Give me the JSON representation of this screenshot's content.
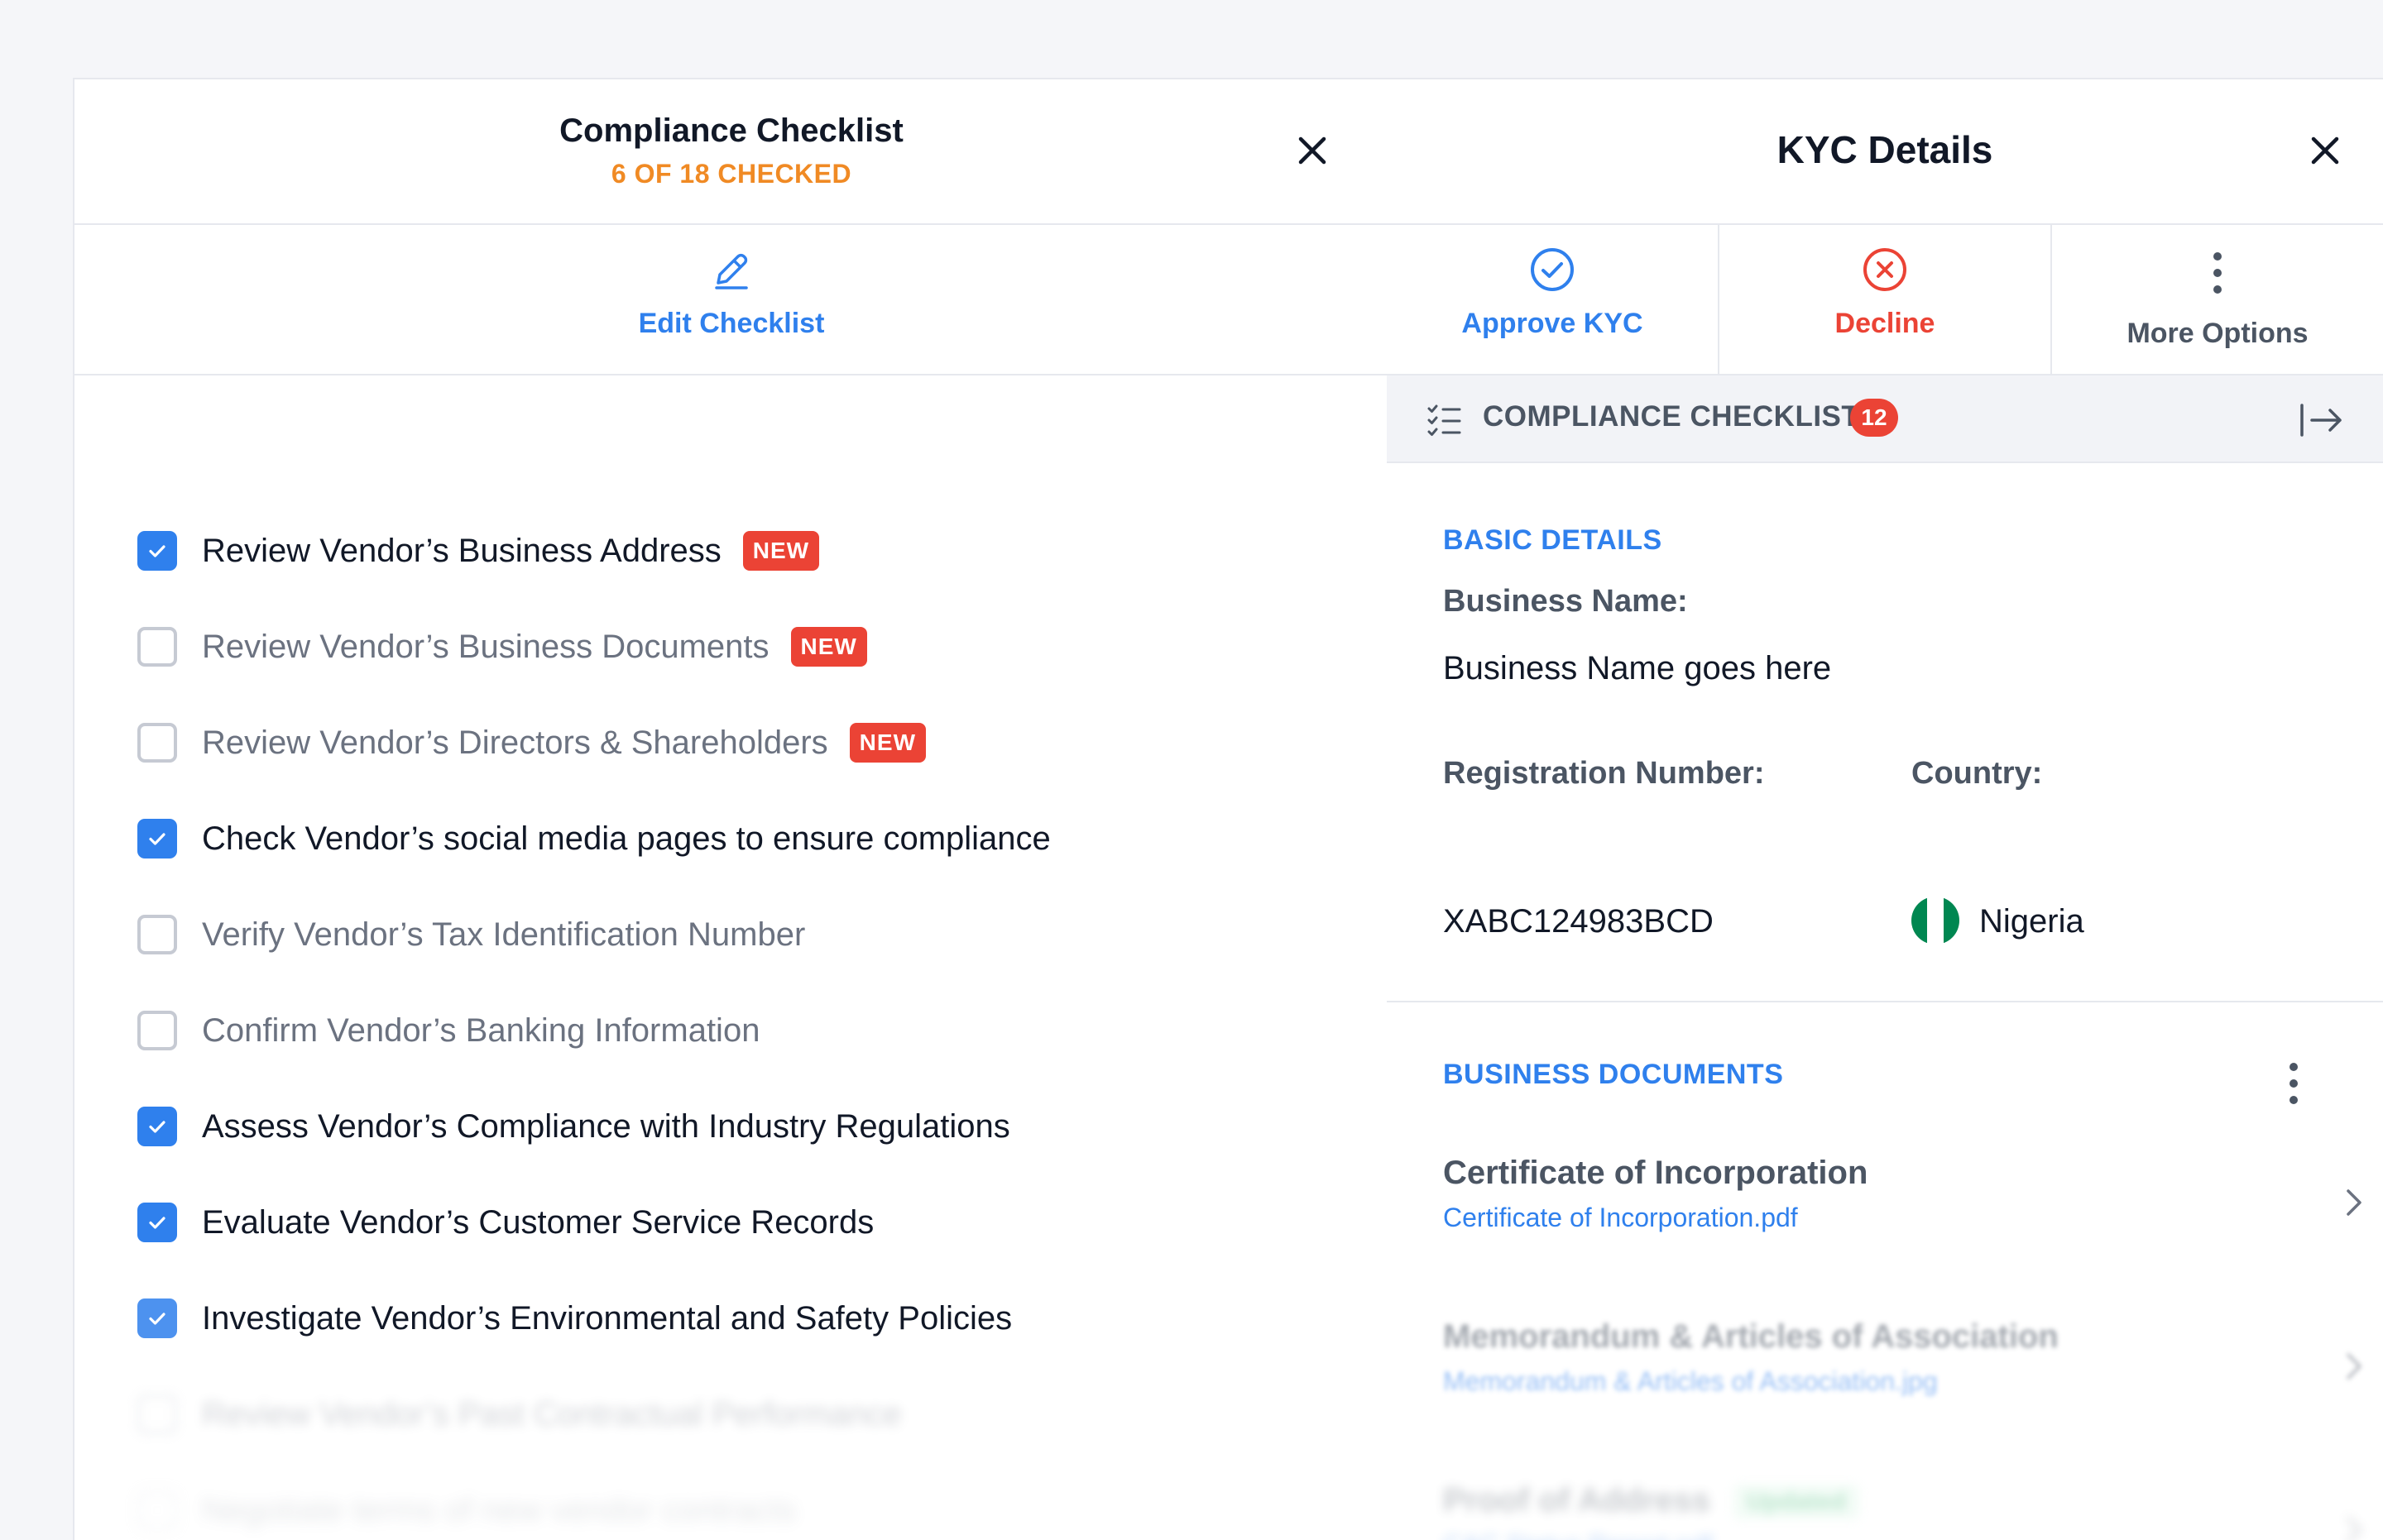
{
  "checklist_panel": {
    "title": "Compliance Checklist",
    "subtitle": "6 OF 18 CHECKED",
    "edit_label": "Edit Checklist",
    "new_badge": "NEW",
    "items": [
      {
        "label": "Review Vendor’s Business Address",
        "checked": true,
        "is_new": true
      },
      {
        "label": "Review Vendor’s Business Documents",
        "checked": false,
        "is_new": true
      },
      {
        "label": "Review Vendor’s Directors & Shareholders",
        "checked": false,
        "is_new": true
      },
      {
        "label": "Check Vendor’s social media pages to ensure compliance",
        "checked": true,
        "is_new": false
      },
      {
        "label": "Verify Vendor’s Tax Identification Number",
        "checked": false,
        "is_new": false
      },
      {
        "label": "Confirm Vendor’s Banking Information",
        "checked": false,
        "is_new": false
      },
      {
        "label": "Assess Vendor’s Compliance with Industry Regulations",
        "checked": true,
        "is_new": false
      },
      {
        "label": "Evaluate Vendor’s Customer Service Records",
        "checked": true,
        "is_new": false
      },
      {
        "label": "Investigate Vendor’s Environmental and Safety Policies",
        "checked": true,
        "is_new": false
      },
      {
        "label": "Review Vendor’s Past Contractual Performance",
        "checked": false,
        "is_new": false
      },
      {
        "label": "Negotiate terms of new vendor contracts",
        "checked": false,
        "is_new": false
      }
    ]
  },
  "kyc_panel": {
    "title": "KYC Details",
    "actions": {
      "approve": "Approve KYC",
      "decline": "Decline",
      "more": "More Options"
    },
    "compliance_bar": {
      "label": "COMPLIANCE CHECKLIST",
      "count": "12"
    },
    "basic_details": {
      "section_title": "BASIC DETAILS",
      "business_name_label": "Business Name:",
      "business_name_value": "Business Name goes here",
      "registration_label": "Registration Number:",
      "registration_value": "XABC124983BCD",
      "country_label": "Country:",
      "country_value": "Nigeria"
    },
    "documents": {
      "section_title": "BUSINESS DOCUMENTS",
      "items": [
        {
          "title": "Certificate of Incorporation",
          "file": "Certificate of Incorporation.pdf"
        },
        {
          "title": "Memorandum & Articles of Association",
          "file": "Memorandum & Articles of Association.jpg"
        },
        {
          "title": "Proof of Address",
          "badge": "Updated",
          "file": "CAC Status Report.pdf"
        }
      ]
    }
  },
  "colors": {
    "accent_blue": "#2f80ed",
    "danger_red": "#eb4335",
    "warning_orange": "#f08a24",
    "nigeria_green": "#008751"
  }
}
